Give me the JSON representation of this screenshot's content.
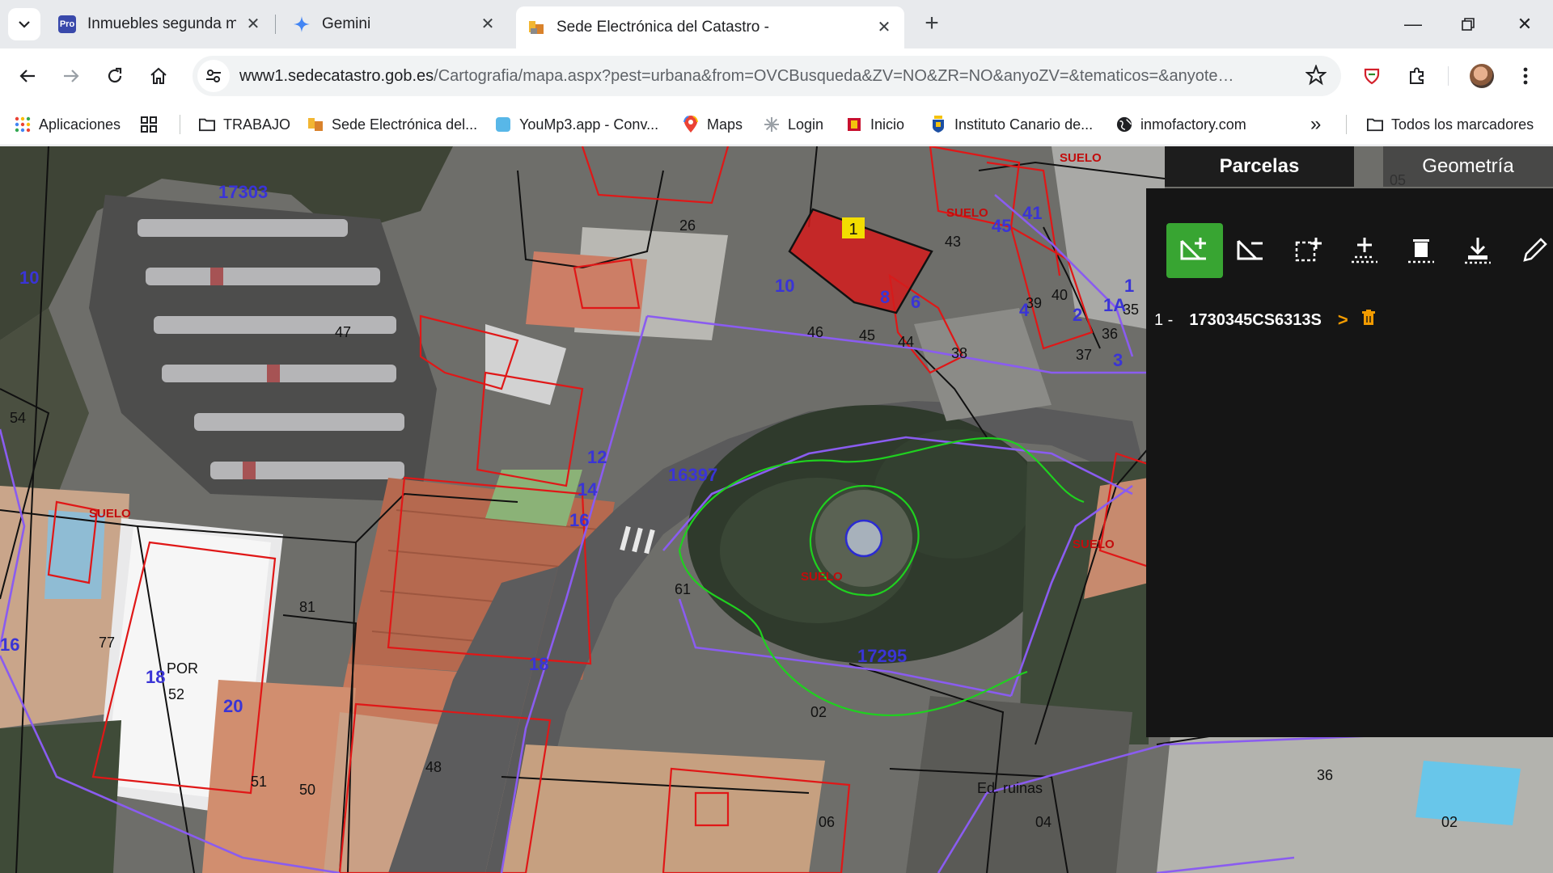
{
  "browser": {
    "tabs": [
      {
        "title": "Inmuebles segunda mano - Fot",
        "favicon": "Pro"
      },
      {
        "title": "Gemini",
        "favicon": ""
      },
      {
        "title": "Sede Electrónica del Catastro - ",
        "favicon": ""
      }
    ],
    "active_tab": 2,
    "url_host": "www1.sedecatastro.gob.es",
    "url_path": "/Cartografia/mapa.aspx?pest=urbana&from=OVCBusqueda&ZV=NO&ZR=NO&anyoZV=&tematicos=&anyote…",
    "bookmarks": [
      {
        "label": "Aplicaciones",
        "icon": "apps-grid-icon"
      },
      {
        "label": "TRABAJO",
        "icon": "folder-icon"
      },
      {
        "label": "Sede Electrónica del...",
        "icon": "catastro-icon"
      },
      {
        "label": "YouMp3.app - Conv...",
        "icon": "yoump3-icon"
      },
      {
        "label": "Maps",
        "icon": "maps-pin-icon"
      },
      {
        "label": "Login",
        "icon": "login-icon"
      },
      {
        "label": "Inicio",
        "icon": "shield-icon"
      },
      {
        "label": "Instituto Canario de...",
        "icon": "crest-icon"
      },
      {
        "label": "inmofactory.com",
        "icon": "globe-icon"
      }
    ],
    "overflow_label": "»",
    "all_bookmarks_label": "Todos los marcadores"
  },
  "panel": {
    "tabs": {
      "parcelas": "Parcelas",
      "geometria": "Geometría"
    },
    "tools": [
      "add-parcel-icon",
      "remove-parcel-icon",
      "select-area-icon",
      "add-point-icon",
      "delete-all-icon",
      "download-icon",
      "edit-icon"
    ],
    "parcel": {
      "index": "1 -",
      "ref": "1730345CS6313S",
      "arrow": ">"
    }
  },
  "map": {
    "selected_label": "1",
    "labels_black": [
      "26",
      "46",
      "45",
      "44",
      "47",
      "43",
      "38",
      "39",
      "40",
      "35",
      "36",
      "37",
      "81",
      "52",
      "51",
      "50",
      "48",
      "61",
      "54",
      "77",
      "02",
      "06",
      "04",
      "36",
      "02",
      "05",
      "Ed. ruinas",
      "POR"
    ],
    "labels_blue": [
      "17303",
      "10",
      "10",
      "8",
      "6",
      "4",
      "2",
      "1",
      "1A",
      "12",
      "14",
      "16",
      "18",
      "16",
      "18",
      "20",
      "17295",
      "16397",
      "45",
      "41",
      "3"
    ],
    "labels_red": [
      "SUELO",
      "SUELO",
      "SUELO",
      "SUELO",
      "SUELO"
    ]
  },
  "colors": {
    "selected_parcel": "#d41c1c",
    "panel_accent": "#38a532",
    "parcel_line": "#e01717",
    "street_line": "#8a5cf0",
    "contour_green": "#1fd11f"
  }
}
